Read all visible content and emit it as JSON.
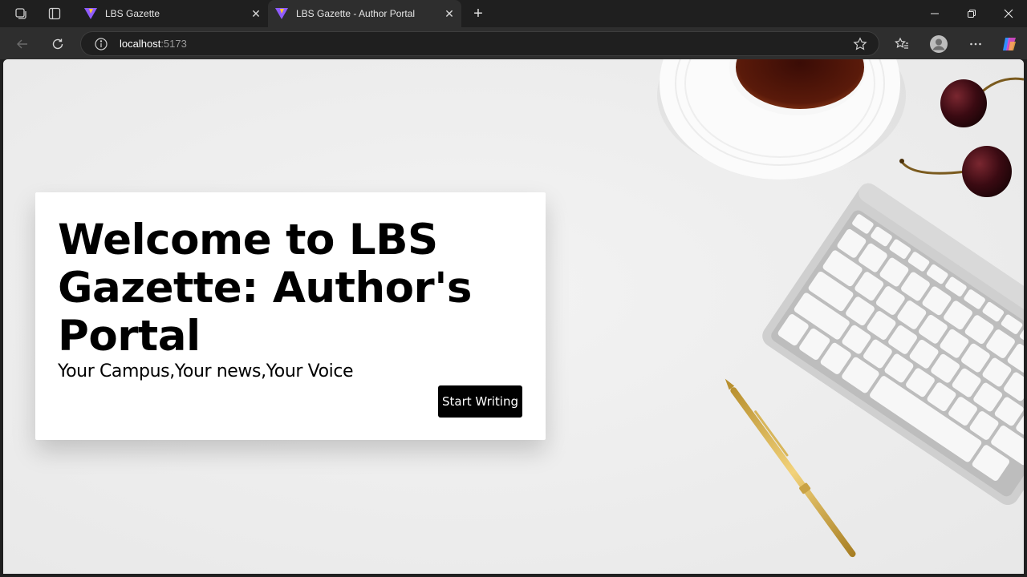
{
  "browser": {
    "tabs": [
      {
        "title": "LBS Gazette",
        "active": false
      },
      {
        "title": "LBS Gazette - Author Portal",
        "active": true
      }
    ],
    "address": {
      "host": "localhost",
      "port": ":5173"
    }
  },
  "page": {
    "heading": "Welcome to LBS Gazette: Author's Portal",
    "tagline": "Your Campus,Your news,Your Voice",
    "cta_label": "Start Writing"
  },
  "colors": {
    "page_background": "#efefef",
    "card_background": "#ffffff",
    "button_background": "#000000",
    "button_text": "#ffffff",
    "browser_chrome": "#2e2e2e"
  }
}
